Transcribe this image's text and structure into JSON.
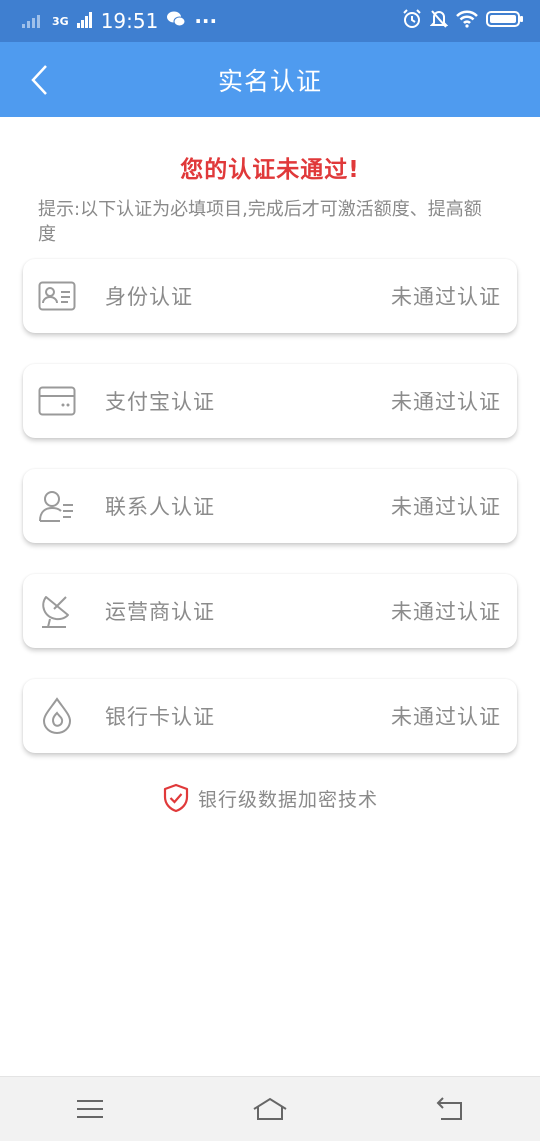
{
  "status_bar": {
    "network": "3G",
    "time": "19:51",
    "more": "···"
  },
  "nav": {
    "title": "实名认证"
  },
  "alert": {
    "title": "您的认证未通过!"
  },
  "hint": "提示:以下认证为必填项目,完成后才可激活额度、提高额度",
  "items": [
    {
      "label": "身份认证",
      "status": "未通过认证",
      "icon": "id-card-icon"
    },
    {
      "label": "支付宝认证",
      "status": "未通过认证",
      "icon": "wallet-card-icon"
    },
    {
      "label": "联系人认证",
      "status": "未通过认证",
      "icon": "contacts-icon"
    },
    {
      "label": "运营商认证",
      "status": "未通过认证",
      "icon": "satellite-dish-icon"
    },
    {
      "label": "银行卡认证",
      "status": "未通过认证",
      "icon": "bank-drop-icon"
    }
  ],
  "security": {
    "text": "银行级数据加密技术",
    "icon": "shield-check-icon"
  },
  "colors": {
    "status_bar": "#3f7fd0",
    "nav_bar": "#4f9bef",
    "alert": "#e0393a",
    "text_gray": "#8b8b8b"
  }
}
